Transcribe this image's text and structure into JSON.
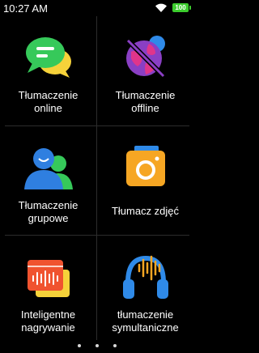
{
  "status_bar": {
    "time": "10:27 AM",
    "battery": "100",
    "wifi_icon": "wifi-icon"
  },
  "tiles": [
    {
      "line1": "Tłumaczenie",
      "line2": "online",
      "icon": "chat-bubbles-icon"
    },
    {
      "line1": "Tłumaczenie",
      "line2": "offline",
      "icon": "globe-offline-icon"
    },
    {
      "line1": "Tłumaczenie",
      "line2": "grupowe",
      "icon": "group-people-icon"
    },
    {
      "line1": "Tłumacz zdjęć",
      "line2": "",
      "icon": "camera-icon"
    },
    {
      "line1": "Inteligentne",
      "line2": "nagrywanie",
      "icon": "recorder-icon"
    },
    {
      "line1": "tłumaczenie",
      "line2": "symultaniczne",
      "icon": "headphones-icon"
    }
  ],
  "colors": {
    "background": "#000000",
    "battery": "#3ccd2e",
    "online_green": "#36c95a",
    "offline_purple": "#8a3fc4",
    "group_blue": "#2f7fe0",
    "camera_orange": "#f6a623",
    "recorder_red": "#f0532f",
    "headphones_blue": "#2f8ae8"
  }
}
